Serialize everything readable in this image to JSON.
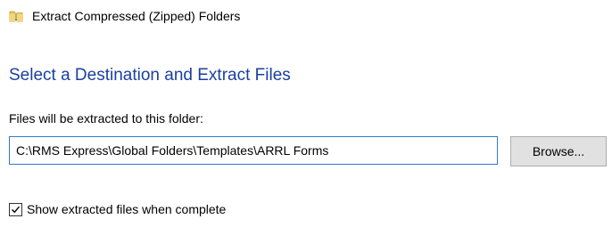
{
  "window": {
    "title": "Extract Compressed (Zipped) Folders",
    "icon": "zip-folder-icon"
  },
  "page": {
    "heading": "Select a Destination and Extract Files"
  },
  "destination": {
    "label": "Files will be extracted to this folder:",
    "value": "C:\\RMS Express\\Global Folders\\Templates\\ARRL Forms",
    "browse_label": "Browse..."
  },
  "options": {
    "show_files_label": "Show extracted files when complete",
    "show_files_checked": true
  },
  "colors": {
    "heading": "#1a3f9e",
    "input_border_focus": "#2f79cf",
    "button_face": "#e1e1e1"
  }
}
